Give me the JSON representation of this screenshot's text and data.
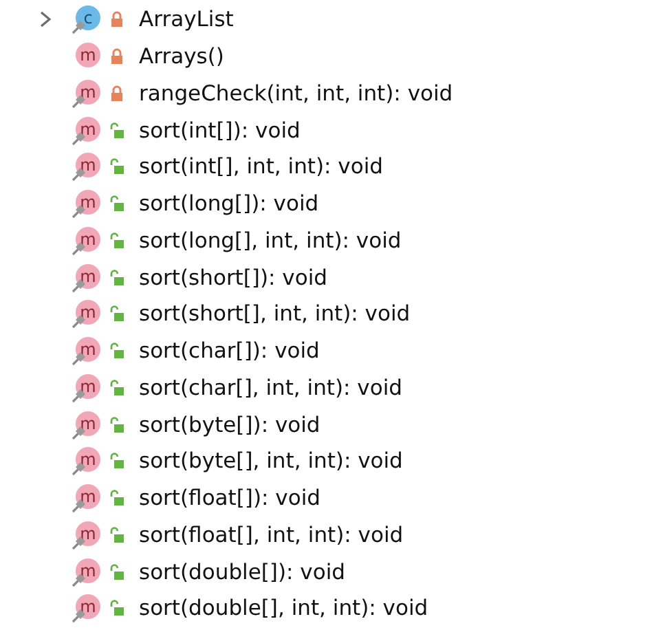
{
  "members": [
    {
      "kind": "class",
      "badge": "c",
      "label": "ArrayList",
      "locked": true,
      "pinned": true,
      "expanded": false
    },
    {
      "kind": "method",
      "badge": "m",
      "label": "Arrays()",
      "locked": true,
      "pinned": false
    },
    {
      "kind": "method",
      "badge": "m",
      "label": "rangeCheck(int, int, int): void",
      "locked": true,
      "pinned": true
    },
    {
      "kind": "method",
      "badge": "m",
      "label": "sort(int[]): void",
      "locked": false,
      "pinned": true
    },
    {
      "kind": "method",
      "badge": "m",
      "label": "sort(int[], int, int): void",
      "locked": false,
      "pinned": true
    },
    {
      "kind": "method",
      "badge": "m",
      "label": "sort(long[]): void",
      "locked": false,
      "pinned": true
    },
    {
      "kind": "method",
      "badge": "m",
      "label": "sort(long[], int, int): void",
      "locked": false,
      "pinned": true
    },
    {
      "kind": "method",
      "badge": "m",
      "label": "sort(short[]): void",
      "locked": false,
      "pinned": true
    },
    {
      "kind": "method",
      "badge": "m",
      "label": "sort(short[], int, int): void",
      "locked": false,
      "pinned": true
    },
    {
      "kind": "method",
      "badge": "m",
      "label": "sort(char[]): void",
      "locked": false,
      "pinned": true
    },
    {
      "kind": "method",
      "badge": "m",
      "label": "sort(char[], int, int): void",
      "locked": false,
      "pinned": true
    },
    {
      "kind": "method",
      "badge": "m",
      "label": "sort(byte[]): void",
      "locked": false,
      "pinned": true
    },
    {
      "kind": "method",
      "badge": "m",
      "label": "sort(byte[], int, int): void",
      "locked": false,
      "pinned": true
    },
    {
      "kind": "method",
      "badge": "m",
      "label": "sort(float[]): void",
      "locked": false,
      "pinned": true
    },
    {
      "kind": "method",
      "badge": "m",
      "label": "sort(float[], int, int): void",
      "locked": false,
      "pinned": true
    },
    {
      "kind": "method",
      "badge": "m",
      "label": "sort(double[]): void",
      "locked": false,
      "pinned": true
    },
    {
      "kind": "method",
      "badge": "m",
      "label": "sort(double[], int, int): void",
      "locked": false,
      "pinned": true
    }
  ]
}
